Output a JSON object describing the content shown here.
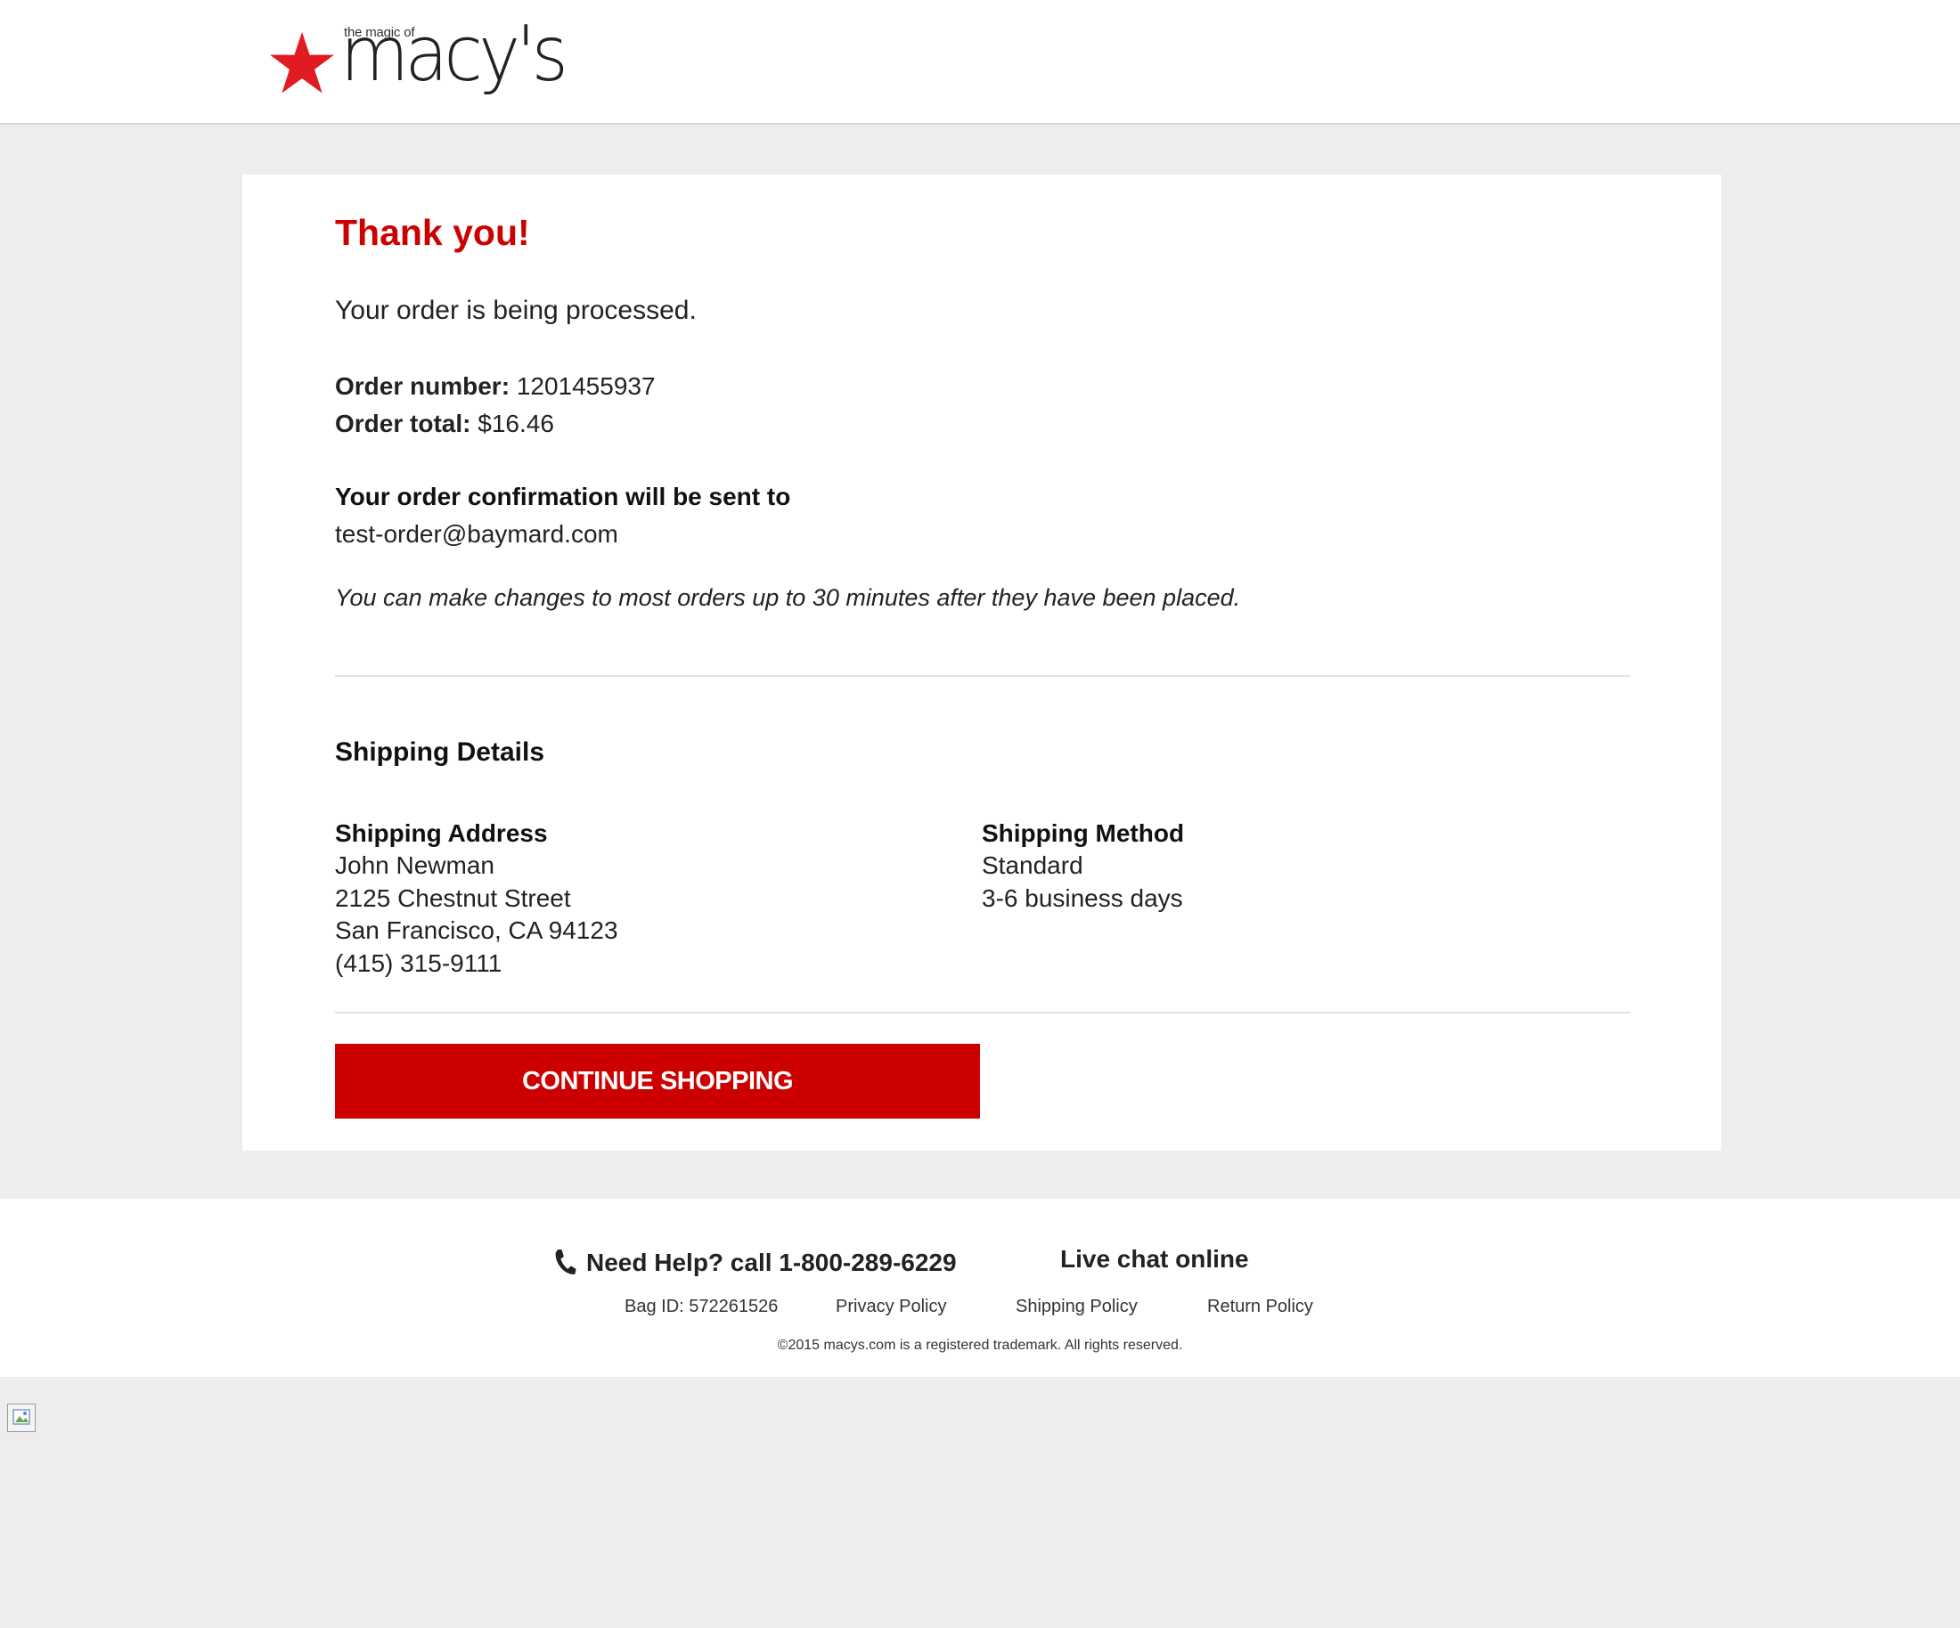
{
  "header": {
    "logo_tagline": "the magic of",
    "logo_word": "macy's",
    "brand_color": "#cc0000"
  },
  "confirmation": {
    "title": "Thank you!",
    "status_text": "Your order is being processed.",
    "order_number_label": "Order number:",
    "order_number": "1201455937",
    "order_total_label": "Order total:",
    "order_total": "$16.46",
    "confirm_label": "Your order confirmation will be sent to",
    "email": "test-order@baymard.com",
    "changes_note": "You can make changes to most orders up to 30 minutes after they have been placed."
  },
  "shipping": {
    "heading": "Shipping Details",
    "address_title": "Shipping Address",
    "address_lines": [
      "John Newman",
      "2125 Chestnut Street",
      "San Francisco, CA 94123",
      "(415) 315-9111"
    ],
    "method_title": "Shipping Method",
    "method_lines": [
      "Standard",
      "3-6 business days"
    ]
  },
  "actions": {
    "continue_label": "CONTINUE SHOPPING"
  },
  "footer": {
    "help_text": "Need Help? call 1-800-289-6229",
    "chat_text": "Live chat online",
    "bag_id": "Bag ID: 572261526",
    "privacy_link": "Privacy Policy",
    "shipping_link": "Shipping Policy",
    "return_link": "Return Policy",
    "copyright": "©2015 macys.com is a registered trademark. All rights reserved."
  }
}
